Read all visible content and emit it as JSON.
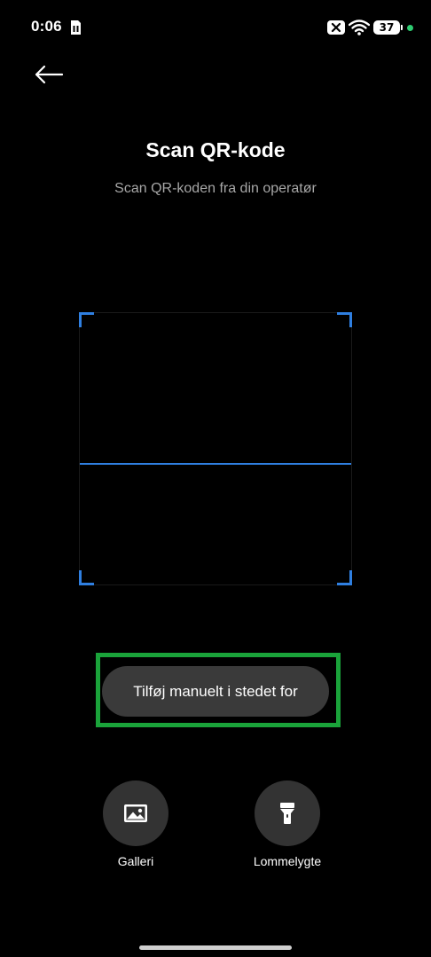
{
  "status_bar": {
    "time": "0:06",
    "battery_level": "37",
    "privacy_dot_color": "#2ecc71",
    "icons": [
      "sim-card-icon",
      "no-sim-icon",
      "wifi-icon",
      "battery-icon",
      "privacy-indicator-dot"
    ]
  },
  "header": {
    "back_icon": "arrow-left-icon",
    "title": "Scan QR-kode",
    "subtitle": "Scan QR-koden fra din operatør"
  },
  "scanner": {
    "frame_color": "#2f7fe0"
  },
  "manual_button": {
    "label": "Tilføj manuelt i stedet for",
    "highlight_color": "#1aa33a"
  },
  "tools": {
    "gallery": {
      "label": "Galleri",
      "icon": "image-icon"
    },
    "flashlight": {
      "label": "Lommelygte",
      "icon": "flashlight-icon"
    }
  }
}
